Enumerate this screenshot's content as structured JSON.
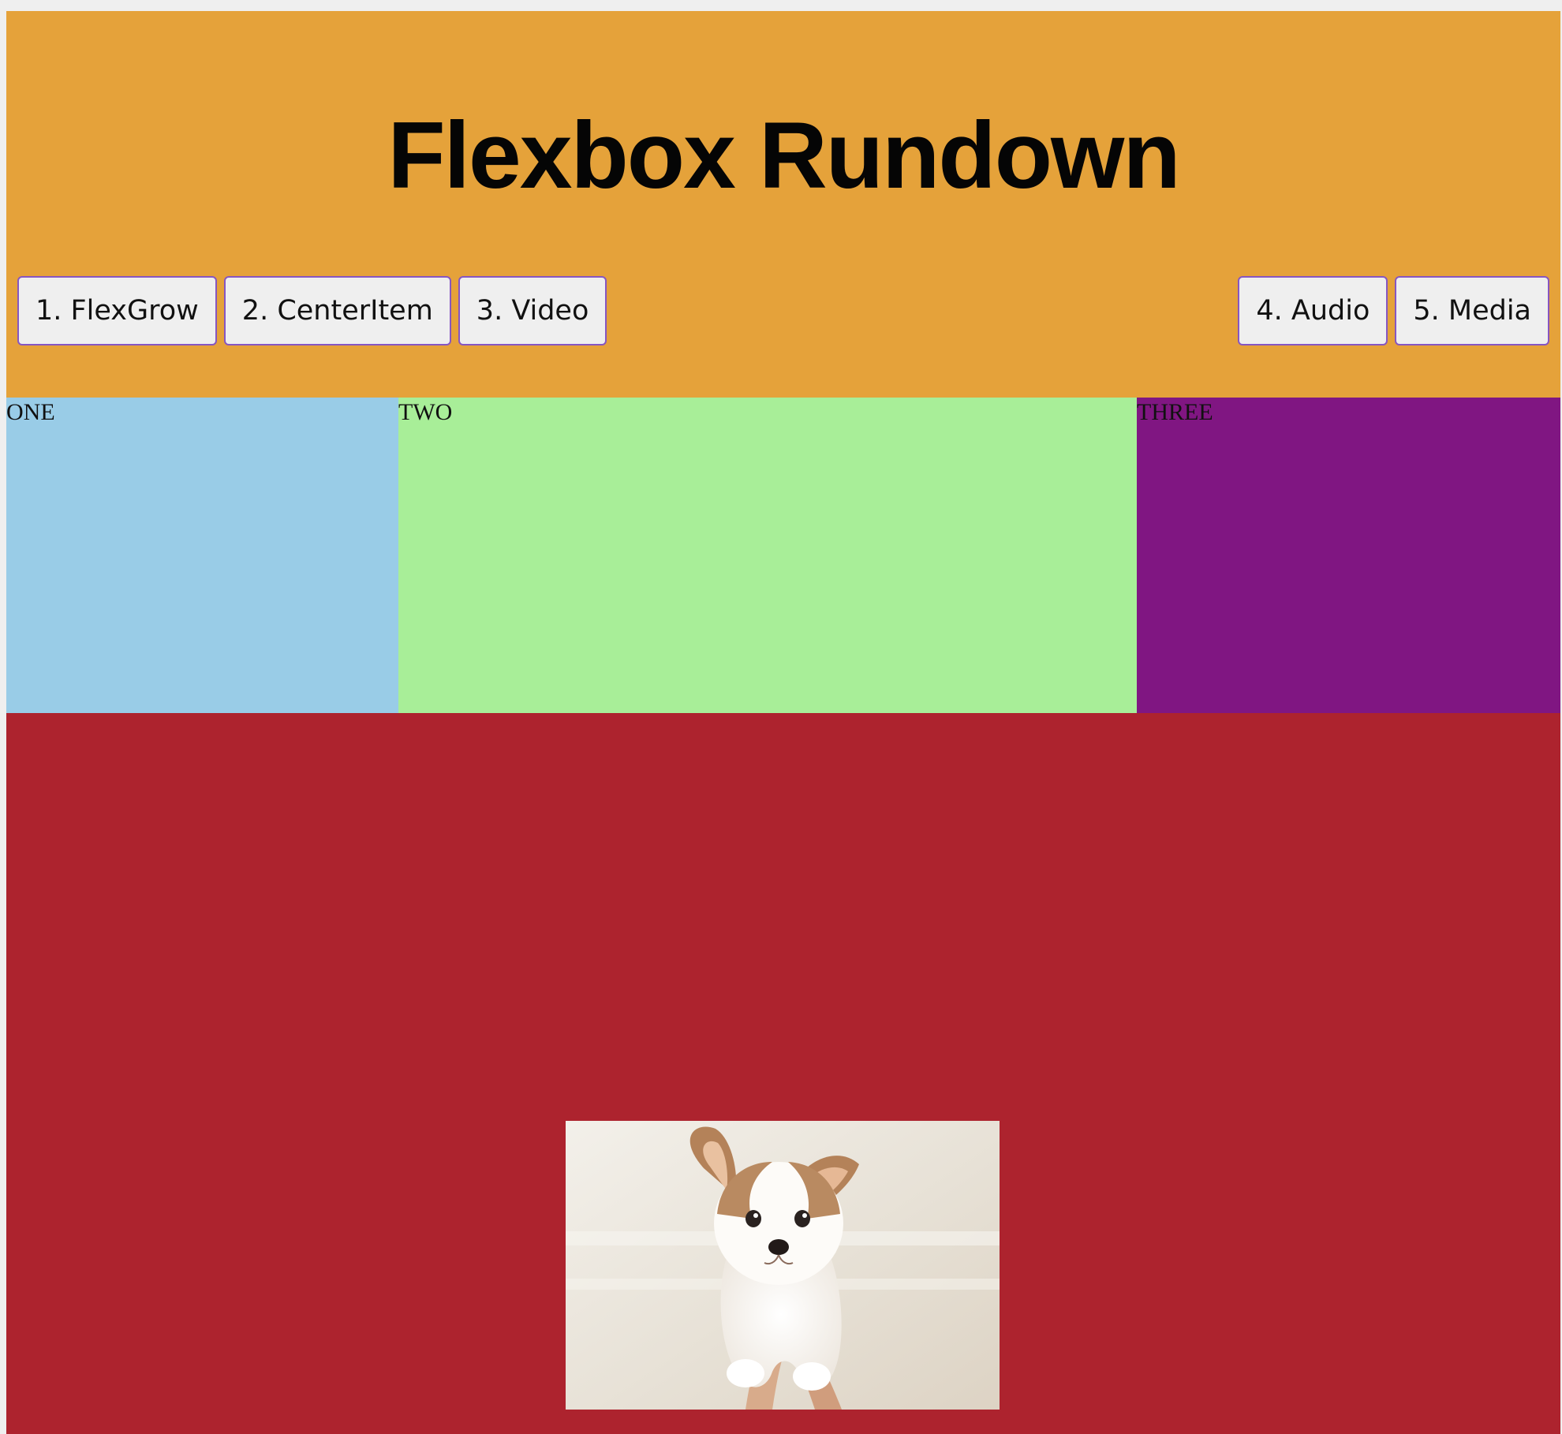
{
  "header": {
    "title": "Flexbox Rundown",
    "nav_left": [
      {
        "label": "1. FlexGrow"
      },
      {
        "label": "2. CenterItem"
      },
      {
        "label": "3. Video"
      }
    ],
    "nav_right": [
      {
        "label": "4. Audio"
      },
      {
        "label": "5. Media"
      }
    ]
  },
  "boxes": [
    {
      "label": "ONE",
      "color": "#99cce7"
    },
    {
      "label": "TWO",
      "color": "#a8ee98"
    },
    {
      "label": "THREE",
      "color": "#801682"
    }
  ],
  "colors": {
    "header_background": "#e5a23a",
    "media_background": "#ad232e",
    "button_border": "#8656c2"
  },
  "media": {
    "image": "puppy-photo"
  }
}
